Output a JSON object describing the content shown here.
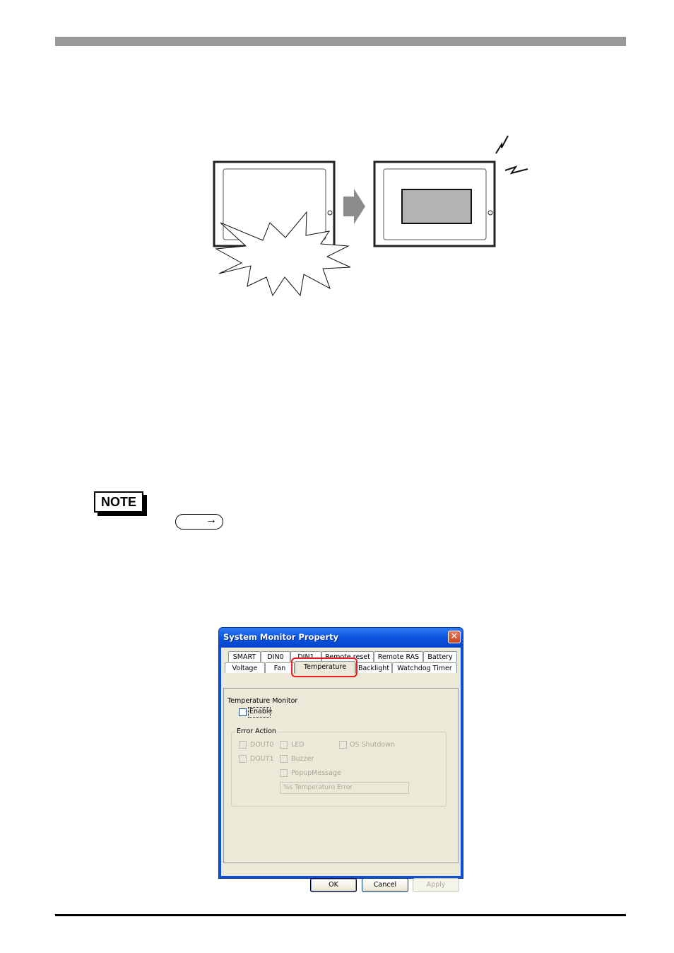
{
  "page": {
    "header_bar_color": "#999999",
    "footer_rule_color": "#000000"
  },
  "figure": {
    "description": "Panel display failure illustration followed by arrow to panel showing error window",
    "left_panel": "display-unit-with-burst",
    "arrow": "right-arrow",
    "right_panel": "display-unit-with-error-window",
    "indicator": "lightning-alert",
    "error_window_fill": "#b3b3b3"
  },
  "note": {
    "badge_label": "NOTE",
    "reference_icon": "reference-arrow-icon",
    "reference_arrow": "→"
  },
  "dialog": {
    "title": "System Monitor Property",
    "close_glyph": "✕",
    "tabs_row1": [
      "SMART",
      "DIN0",
      "DIN1",
      "Remote reset",
      "Remote RAS",
      "Battery"
    ],
    "tabs_row2": [
      "Voltage",
      "Fan",
      "Temperature",
      "Backlight",
      "Watchdog Timer"
    ],
    "active_tab": "Temperature",
    "highlight_color": "#ee1c1c",
    "section_label": "Temperature Monitor",
    "enable_label": "Enable",
    "enable_checked": false,
    "error_action": {
      "legend": "Error Action",
      "options": [
        {
          "label": "DOUT0",
          "checked": false,
          "enabled": false
        },
        {
          "label": "DOUT1",
          "checked": false,
          "enabled": false
        },
        {
          "label": "LED",
          "checked": false,
          "enabled": false
        },
        {
          "label": "Buzzer",
          "checked": false,
          "enabled": false
        },
        {
          "label": "PopupMessage",
          "checked": false,
          "enabled": false
        },
        {
          "label": "OS Shutdown",
          "checked": false,
          "enabled": false
        }
      ],
      "message_value": "%s Temperature Error"
    },
    "buttons": {
      "ok": "OK",
      "cancel": "Cancel",
      "apply": "Apply"
    }
  }
}
